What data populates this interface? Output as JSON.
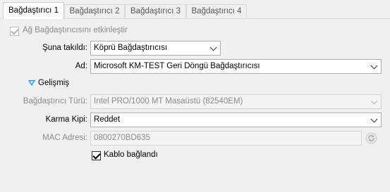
{
  "tabs": [
    {
      "label": "Bağdaştırıcı 1",
      "active": true
    },
    {
      "label": "Bağdaştırıcı 2",
      "active": false
    },
    {
      "label": "Bağdaştırıcı 3",
      "active": false
    },
    {
      "label": "Bağdaştırıcı 4",
      "active": false
    }
  ],
  "enable_adapter": {
    "label": "Ağ Bağdaştırıcısını etkinleştir",
    "checked": true,
    "enabled": false
  },
  "attached_to": {
    "label": "Şuna takıldı:",
    "value": "Köprü Bağdaştırıcısı"
  },
  "name": {
    "label": "Ad:",
    "value": "Microsoft KM-TEST Geri Döngü Bağdaştırıcısı"
  },
  "advanced": {
    "label": "Gelişmiş",
    "expanded": true
  },
  "adapter_type": {
    "label": "Bağdaştırıcı Türü:",
    "value": "Intel PRO/1000 MT Masaüstü (82540EM)",
    "enabled": false
  },
  "promiscuous": {
    "label": "Karma Kipi:",
    "value": "Reddet"
  },
  "mac": {
    "label": "MAC Adresi:",
    "value": "0800270BD635",
    "enabled": false
  },
  "cable": {
    "label": "Kablo bağlandı",
    "checked": true
  },
  "colors": {
    "accent": "#1e90ff",
    "panel_bg": "#f0f0f0",
    "disabled_text": "#8a8a8a"
  }
}
